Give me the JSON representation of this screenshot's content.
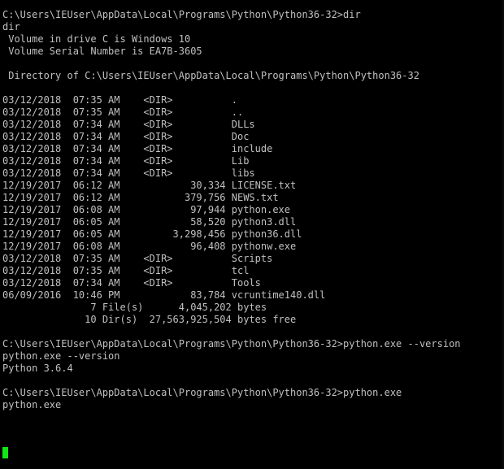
{
  "console": {
    "lines": [
      "C:\\Users\\IEUser\\AppData\\Local\\Programs\\Python\\Python36-32>dir",
      "dir",
      " Volume in drive C is Windows 10",
      " Volume Serial Number is EA7B-3605",
      "",
      " Directory of C:\\Users\\IEUser\\AppData\\Local\\Programs\\Python\\Python36-32",
      "",
      "03/12/2018  07:35 AM    <DIR>          .",
      "03/12/2018  07:35 AM    <DIR>          ..",
      "03/12/2018  07:34 AM    <DIR>          DLLs",
      "03/12/2018  07:34 AM    <DIR>          Doc",
      "03/12/2018  07:34 AM    <DIR>          include",
      "03/12/2018  07:34 AM    <DIR>          Lib",
      "03/12/2018  07:34 AM    <DIR>          libs",
      "12/19/2017  06:12 AM            30,334 LICENSE.txt",
      "12/19/2017  06:12 AM           379,756 NEWS.txt",
      "12/19/2017  06:08 AM            97,944 python.exe",
      "12/19/2017  06:05 AM            58,520 python3.dll",
      "12/19/2017  06:05 AM         3,298,456 python36.dll",
      "12/19/2017  06:08 AM            96,408 pythonw.exe",
      "03/12/2018  07:35 AM    <DIR>          Scripts",
      "03/12/2018  07:35 AM    <DIR>          tcl",
      "03/12/2018  07:34 AM    <DIR>          Tools",
      "06/09/2016  10:46 PM            83,784 vcruntime140.dll",
      "               7 File(s)      4,045,202 bytes",
      "              10 Dir(s)  27,563,925,504 bytes free",
      "",
      "C:\\Users\\IEUser\\AppData\\Local\\Programs\\Python\\Python36-32>python.exe --version",
      "python.exe --version",
      "Python 3.6.4",
      "",
      "C:\\Users\\IEUser\\AppData\\Local\\Programs\\Python\\Python36-32>python.exe",
      "python.exe"
    ]
  },
  "colors": {
    "background": "#000000",
    "text": "#c0c0c0",
    "cursor": "#13e613"
  }
}
